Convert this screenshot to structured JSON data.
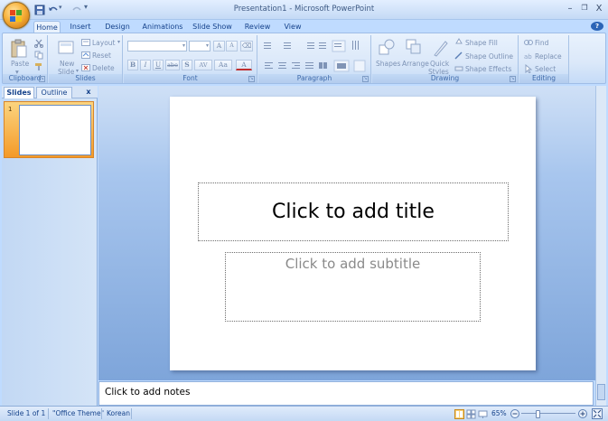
{
  "window": {
    "title": "Presentation1 - Microsoft PowerPoint"
  },
  "controls": {
    "minimize": "–",
    "restore": "❐",
    "close": "X",
    "help": "?"
  },
  "tabs": [
    "Home",
    "Insert",
    "Design",
    "Animations",
    "Slide Show",
    "Review",
    "View"
  ],
  "active_tab": "Home",
  "ribbon": {
    "clipboard": {
      "paste": "Paste",
      "label": "Clipboard"
    },
    "slides": {
      "new_slide": "New",
      "new_slide2": "Slide",
      "layout": "Layout",
      "reset": "Reset",
      "delete": "Delete",
      "label": "Slides"
    },
    "font": {
      "label": "Font",
      "bold": "B",
      "italic": "I",
      "underline": "U",
      "strike": "abe",
      "shadow": "S",
      "spacing": "AV",
      "case": "Aa",
      "color": "A",
      "grow": "A",
      "shrink": "A"
    },
    "paragraph": {
      "label": "Paragraph"
    },
    "drawing": {
      "shapes": "Shapes",
      "arrange": "Arrange",
      "quick": "Quick",
      "styles": "Styles",
      "fill": "Shape Fill",
      "outline": "Shape Outline",
      "effects": "Shape Effects",
      "label": "Drawing"
    },
    "editing": {
      "find": "Find",
      "replace": "Replace",
      "select": "Select",
      "label": "Editing"
    }
  },
  "panel": {
    "tab_slides": "Slides",
    "tab_outline": "Outline",
    "close": "x",
    "slide_number": "1"
  },
  "slide": {
    "title_placeholder": "Click to add title",
    "subtitle_placeholder": "Click to add subtitle"
  },
  "notes": {
    "placeholder": "Click to add notes"
  },
  "status": {
    "slide_info": "Slide 1 of 1",
    "theme": "\"Office Theme\"",
    "language": "Korean",
    "zoom": "65%"
  },
  "colors": {
    "accent": "#15428b",
    "ribbon_bg": "#dbe8f9",
    "office_orange": "#f8b23c"
  }
}
